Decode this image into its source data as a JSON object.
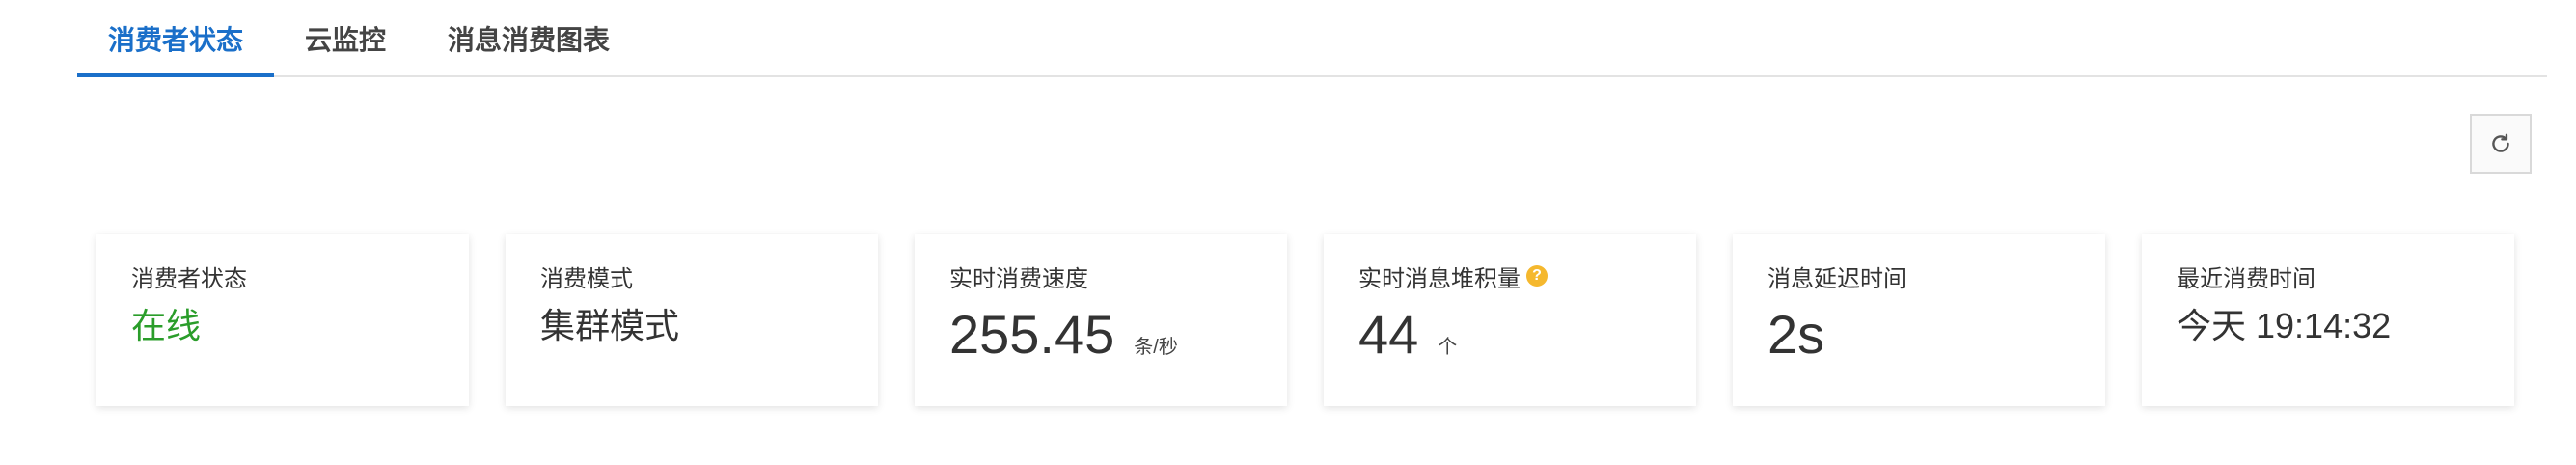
{
  "tabs": [
    {
      "label": "消费者状态",
      "active": true
    },
    {
      "label": "云监控",
      "active": false
    },
    {
      "label": "消息消费图表",
      "active": false
    }
  ],
  "refresh": {
    "icon": "refresh-icon"
  },
  "cards": {
    "status": {
      "title": "消费者状态",
      "value": "在线"
    },
    "mode": {
      "title": "消费模式",
      "value": "集群模式"
    },
    "speed": {
      "title": "实时消费速度",
      "value": "255.45",
      "unit": "条/秒"
    },
    "backlog": {
      "title": "实时消息堆积量",
      "help_icon": "question-circle-icon",
      "help_glyph": "?",
      "value": "44",
      "unit": "个"
    },
    "delay": {
      "title": "消息延迟时间",
      "value": "2s"
    },
    "last": {
      "title": "最近消费时间",
      "value": "今天 19:14:32"
    }
  },
  "colors": {
    "accent": "#1a6fc9",
    "online": "#2a9d2a",
    "help": "#f5b82e"
  }
}
